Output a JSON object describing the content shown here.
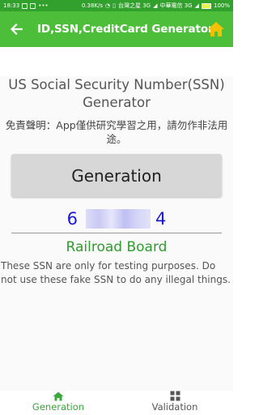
{
  "status_bar": {
    "time": "18:33",
    "speed": "0.38K/s",
    "carrier1": "台灣之星 3G",
    "carrier2": "中華電信 3G",
    "battery": "100%"
  },
  "app_bar": {
    "title": "ID,SSN,CreditCard Generator"
  },
  "main": {
    "title": "US Social Security Number(SSN) Generator",
    "disclaimer": "免責聲明：App僅供研究學習之用，請勿作非法用途。",
    "generate_button": "Generation",
    "ssn_prefix": "6",
    "ssn_suffix": "4",
    "issuer": "Railroad Board",
    "notice": "These SSN are only for testing purposes. Do not use these fake SSN to do any illegal things."
  },
  "bottom_nav": {
    "tabs": [
      {
        "label": "Generation",
        "icon": "home-icon",
        "active": true
      },
      {
        "label": "Validation",
        "icon": "grid-icon",
        "active": false
      }
    ]
  },
  "colors": {
    "status_bar": "#32a02c",
    "app_bar": "#4cbe3a",
    "home_icon": "#f2c200",
    "ssn_text": "#1a1ad6",
    "issuer_text": "#2e9d2e",
    "active_tab": "#3aa83a"
  }
}
